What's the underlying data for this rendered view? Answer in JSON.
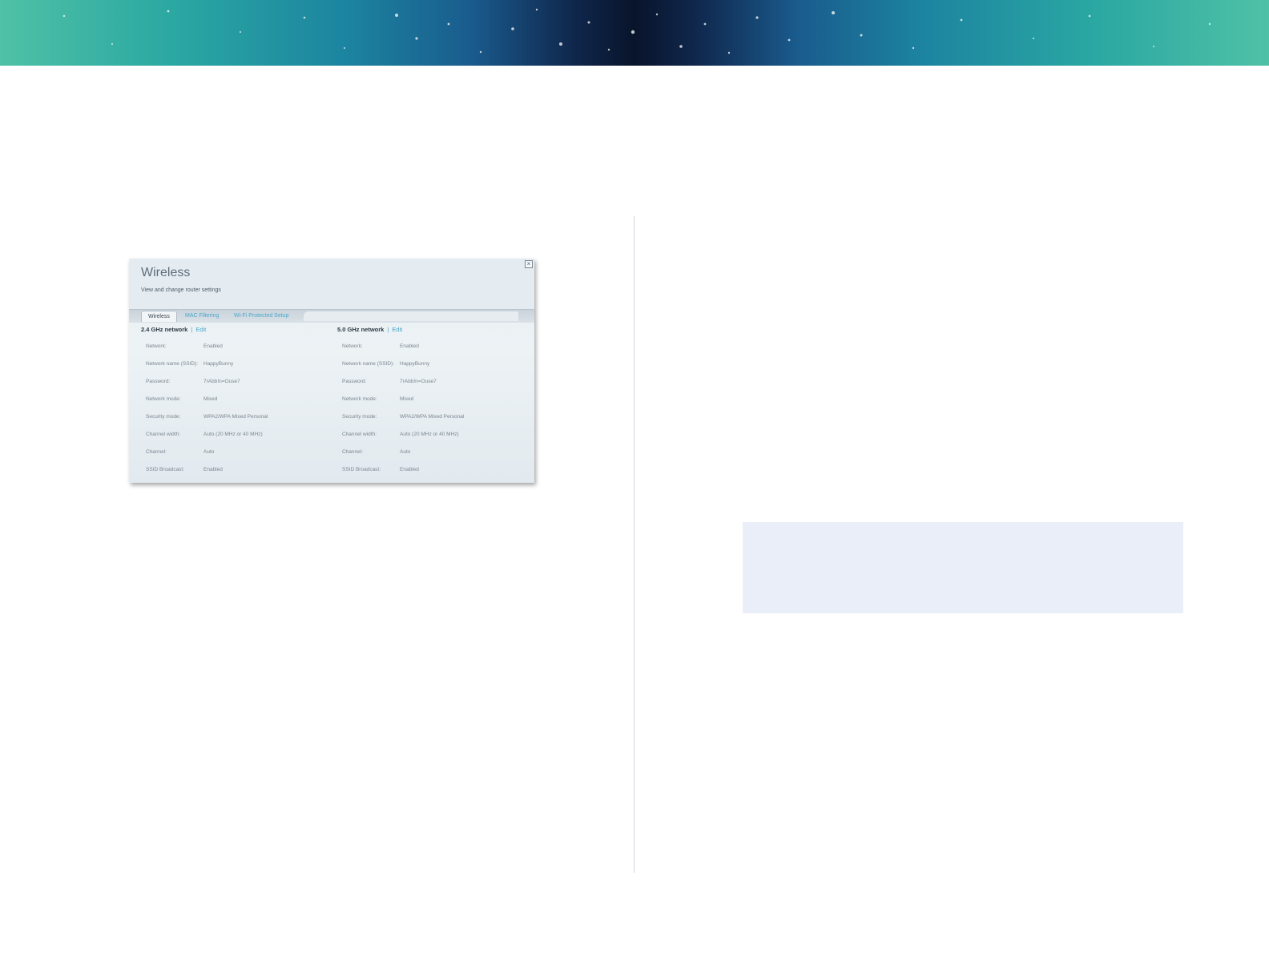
{
  "dialog": {
    "title": "Wireless",
    "subtitle": "View and change router settings",
    "close_glyph": "×"
  },
  "tabs": [
    {
      "label": "Wireless",
      "active": true
    },
    {
      "label": "MAC Filtering",
      "active": false
    },
    {
      "label": "Wi-Fi Protected Setup",
      "active": false
    }
  ],
  "networks": [
    {
      "heading": "2.4 GHz network",
      "separator": "|",
      "edit_label": "Edit",
      "rows": [
        {
          "label": "Network:",
          "value": "Enabled"
        },
        {
          "label": "Network name (SSID):",
          "value": "HappyBunny"
        },
        {
          "label": "Password:",
          "value": "7rAbb!n=Ouse7"
        },
        {
          "label": "Network mode:",
          "value": "Mixed"
        },
        {
          "label": "Security mode:",
          "value": "WPA2/WPA Mixed Personal"
        },
        {
          "label": "Channel width:",
          "value": "Auto (20 MHz or 40 MHz)"
        },
        {
          "label": "Channel:",
          "value": "Auto"
        },
        {
          "label": "SSID Broadcast:",
          "value": "Enabled"
        }
      ]
    },
    {
      "heading": "5.0 GHz network",
      "separator": "|",
      "edit_label": "Edit",
      "rows": [
        {
          "label": "Network:",
          "value": "Enabled"
        },
        {
          "label": "Network name (SSID):",
          "value": "HappyBunny"
        },
        {
          "label": "Password:",
          "value": "7rAbb!n=Ouse7"
        },
        {
          "label": "Network mode:",
          "value": "Mixed"
        },
        {
          "label": "Security mode:",
          "value": "WPA2/WPA Mixed Personal"
        },
        {
          "label": "Channel width:",
          "value": "Auto (20 MHz or 40 MHz)"
        },
        {
          "label": "Channel:",
          "value": "Auto"
        },
        {
          "label": "SSID Broadcast:",
          "value": "Enabled"
        }
      ]
    }
  ],
  "colors": {
    "link": "#4ba7c9",
    "note_box": "#e9eef8"
  }
}
